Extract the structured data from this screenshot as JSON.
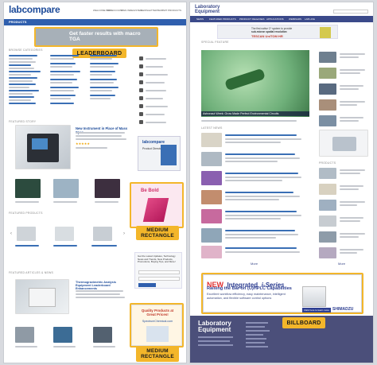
{
  "left_site": {
    "logo": "labcompare",
    "nav_top": [
      "WELCOME BACK",
      "MY ACCOUNT",
      "SIGN IN",
      "REGISTER",
      "NEWSLETTERS",
      "SUBMIT PRODUCTS"
    ],
    "nav_tab": "PRODUCTS",
    "leaderboard_ad": "Get faster results with macro TGA",
    "leaderboard_label": "LEADERBOARD",
    "section_browse": "BROWSE CATEGORIES",
    "section_featured_story": "FEATURED STORY",
    "story_title": "New Instrument in Place of Mass Spec",
    "section_featured_products": "FEATURED PRODUCTS",
    "section_featured_articles": "FEATURED ARTICLES & NEWS",
    "article_title": "Thermogravimetric Analysis Equipment Leaderboard Enhancements",
    "medium_rect_1_text": "Be Bold",
    "medium_rect_1_label": "MEDIUM RECTANGLE",
    "medium_rect_2_text": "Quality Products at Great Prices!",
    "medium_rect_2_brand": "SpectrumChemical.com",
    "medium_rect_2_label": "MEDIUM RECTANGLE",
    "subscribe_title": "Get the Latest Updates, Technology News and Trends, New Products, Promotions, Buying Tips, and More!",
    "side_ad_brand": "labcompare",
    "side_ad_text": "Product Directory"
  },
  "right_site": {
    "logo_line1": "Laboratory",
    "logo_line2": "Equipment",
    "nav": [
      "NEWS",
      "FEATURED PRODUCTS",
      "PRODUCT RELEASES",
      "APPLICATIONS",
      "WEBINARS",
      "LAB LIFE"
    ],
    "top_ad_line1": "The first native C* system to provide",
    "top_ad_line2": "sub-micron spatial resolution",
    "top_ad_brand": "TESCAN UniTOM HR",
    "section_special": "SPECIAL FEATURE",
    "feature_caption": "Astronaut Week: Grow Made Perfect Environmental Circuits",
    "section_latest": "LATEST NEWS",
    "more_label": "More",
    "billboard_new": "NEW",
    "billboard_integrated": "Integrated",
    "billboard_series": "i-Series",
    "billboard_headline": "Raising the Bar on (U)HPLC Capabilities",
    "billboard_body": "Excellent workflow efficiency, easy maintenance, intelligent automation, and flexible software control options",
    "billboard_cta": "Click here to learn more",
    "billboard_brand": "SHIMADZU",
    "billboard_label": "BILLBOARD",
    "footer_logo_line1": "Laboratory",
    "footer_logo_line2": "Equipment",
    "section_products": "PRODUCTS",
    "section_webinars": "WEBINARS"
  },
  "colors": {
    "tag_yellow": "#f3b62a",
    "lab_equipment_blue": "#3b4a8a",
    "labcompare_blue": "#1e4c9a",
    "shimadzu_blue": "#2d3e91"
  }
}
